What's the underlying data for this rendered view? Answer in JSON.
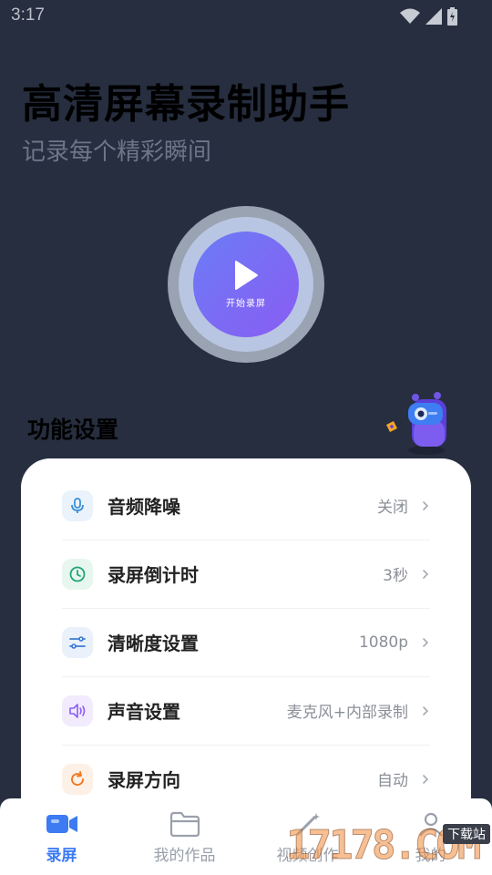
{
  "status_bar": {
    "time": "3:17"
  },
  "hero": {
    "title": "高清屏幕录制助手",
    "subtitle": "记录每个精彩瞬间",
    "record_button_label": "开始录屏"
  },
  "section": {
    "title": "功能设置"
  },
  "settings": [
    {
      "label": "音频降噪",
      "value": "关闭",
      "icon": "microphone-icon",
      "icon_color": "#3a8fd6",
      "icon_bg": "#eaf3fb"
    },
    {
      "label": "录屏倒计时",
      "value": "3秒",
      "icon": "clock-icon",
      "icon_color": "#1fa67a",
      "icon_bg": "#e8f6f0"
    },
    {
      "label": "清晰度设置",
      "value": "1080p",
      "icon": "sliders-icon",
      "icon_color": "#3a7bd5",
      "icon_bg": "#eaf1fb"
    },
    {
      "label": "声音设置",
      "value": "麦克风+内部录制",
      "icon": "speaker-icon",
      "icon_color": "#8b5cf6",
      "icon_bg": "#f1ebfd"
    },
    {
      "label": "录屏方向",
      "value": "自动",
      "icon": "rotate-icon",
      "icon_color": "#f0781f",
      "icon_bg": "#fdf0e6"
    }
  ],
  "tabs": [
    {
      "label": "录屏",
      "icon": "video-camera-icon",
      "active": true
    },
    {
      "label": "我的作品",
      "icon": "folder-icon",
      "active": false
    },
    {
      "label": "视频创作",
      "icon": "magic-wand-icon",
      "active": false
    },
    {
      "label": "我的",
      "icon": "profile-icon",
      "active": false
    }
  ],
  "watermark": {
    "text": "17178.COM",
    "tag": "下载站"
  },
  "colors": {
    "background": "#262e3f",
    "accent": "#3c7bf2",
    "record_gradient_start": "#6b7cf6",
    "record_gradient_end": "#8a5cf2"
  }
}
